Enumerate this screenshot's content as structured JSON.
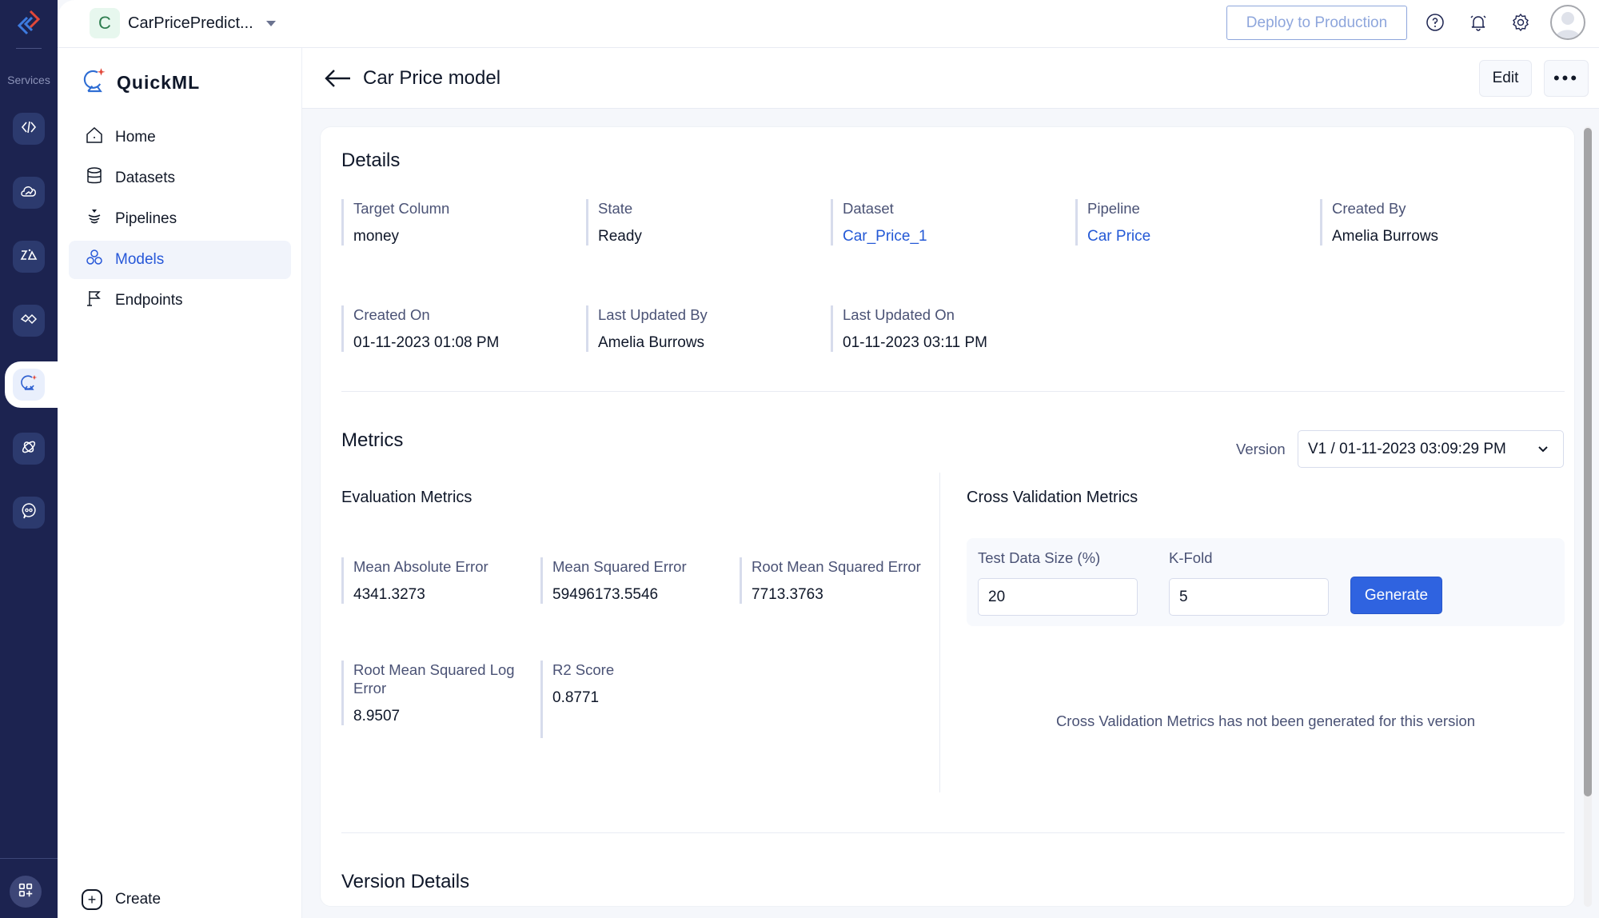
{
  "rail": {
    "services_label": "Services",
    "items": [
      {
        "name": "api-gateway",
        "icon": "code-brackets-icon"
      },
      {
        "name": "cloud-scale",
        "icon": "cloud-chart-icon"
      },
      {
        "name": "zia",
        "icon": "zia-icon"
      },
      {
        "name": "integrations",
        "icon": "handshake-icon"
      },
      {
        "name": "quickml",
        "icon": "quickml-icon",
        "active": true
      },
      {
        "name": "connectors",
        "icon": "link-orbit-icon"
      },
      {
        "name": "convokraft",
        "icon": "chat-bot-icon"
      }
    ],
    "apps_icon": "apps-add-icon"
  },
  "topbar": {
    "project_initial": "C",
    "project_name": "CarPricePredict...",
    "deploy_label": "Deploy to Production",
    "icons": [
      "help-icon",
      "bell-icon",
      "settings-icon",
      "user-avatar"
    ]
  },
  "sidebar": {
    "brand": "QuickML",
    "items": [
      {
        "label": "Home",
        "icon": "home-icon"
      },
      {
        "label": "Datasets",
        "icon": "database-icon"
      },
      {
        "label": "Pipelines",
        "icon": "pipeline-icon"
      },
      {
        "label": "Models",
        "icon": "models-icon",
        "active": true
      },
      {
        "label": "Endpoints",
        "icon": "flag-icon"
      }
    ],
    "create_label": "Create"
  },
  "header": {
    "title": "Car Price model",
    "edit_label": "Edit",
    "more_label": "•••"
  },
  "details": {
    "title": "Details",
    "fields": [
      {
        "label": "Target Column",
        "value": "money",
        "link": false
      },
      {
        "label": "State",
        "value": "Ready",
        "link": false
      },
      {
        "label": "Dataset",
        "value": "Car_Price_1",
        "link": true
      },
      {
        "label": "Pipeline",
        "value": "Car Price",
        "link": true
      },
      {
        "label": "Created By",
        "value": "Amelia Burrows",
        "link": false
      },
      {
        "label": "Created On",
        "value": "01-11-2023 01:08 PM",
        "link": false
      },
      {
        "label": "Last Updated By",
        "value": "Amelia Burrows",
        "link": false
      },
      {
        "label": "Last Updated On",
        "value": "01-11-2023 03:11 PM",
        "link": false
      }
    ]
  },
  "metrics": {
    "title": "Metrics",
    "version_label": "Version",
    "version_selected": "V1 / 01-11-2023 03:09:29 PM",
    "evaluation": {
      "title": "Evaluation Metrics",
      "items": [
        {
          "label": "Mean Absolute Error",
          "value": "4341.3273"
        },
        {
          "label": "Mean Squared Error",
          "value": "59496173.5546"
        },
        {
          "label": "Root Mean Squared Error",
          "value": "7713.3763"
        },
        {
          "label": "Root Mean Squared Log Error",
          "value": "8.9507"
        },
        {
          "label": "R2 Score",
          "value": "0.8771"
        }
      ]
    },
    "cross_validation": {
      "title": "Cross Validation Metrics",
      "test_size_label": "Test Data Size (%)",
      "test_size_value": "20",
      "kfold_label": "K-Fold",
      "kfold_value": "5",
      "generate_label": "Generate",
      "empty_message": "Cross Validation Metrics has not been generated for this version"
    }
  },
  "version_details": {
    "title": "Version Details"
  },
  "colors": {
    "rail_bg": "#1c2350",
    "accent": "#2f63e0",
    "link": "#2459d6",
    "active_nav": "#2657d8"
  }
}
